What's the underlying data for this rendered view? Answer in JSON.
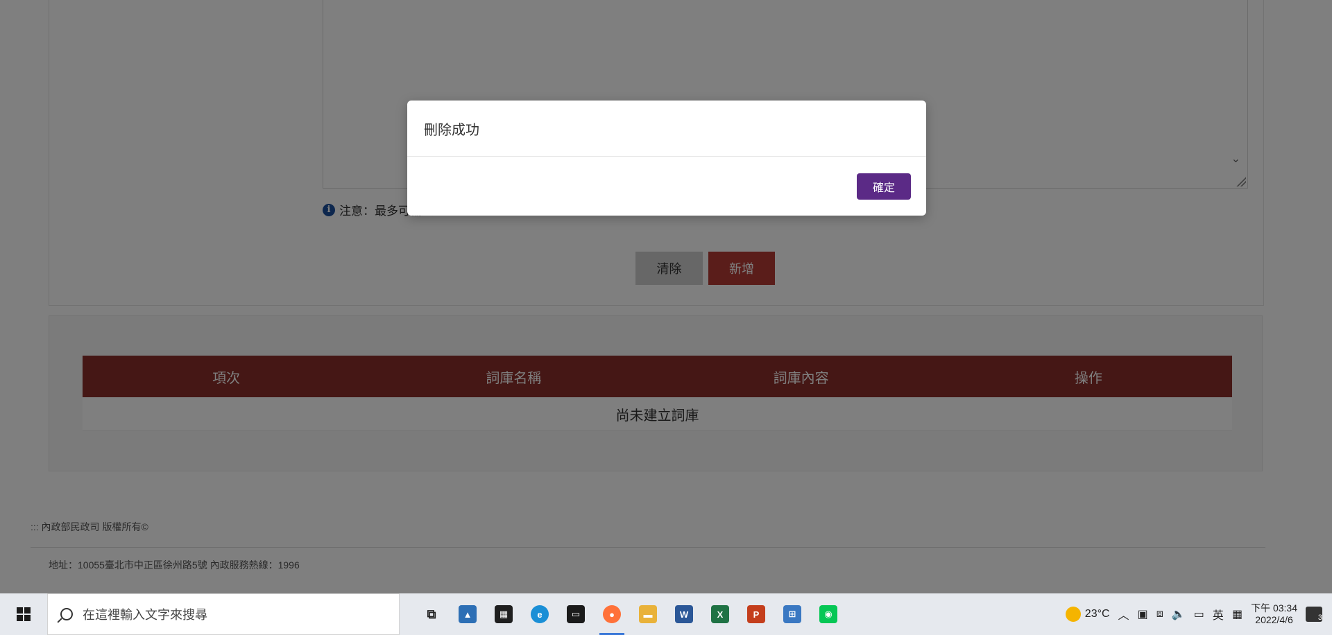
{
  "page": {
    "note_text": "注意：最多可輸入",
    "clear_label": "清除",
    "add_label": "新增",
    "table": {
      "headers": [
        "項次",
        "詞庫名稱",
        "詞庫內容",
        "操作"
      ],
      "empty_text": "尚未建立詞庫"
    },
    "footer": {
      "copyright": "::: 內政部民政司 版權所有©",
      "address": "地址：10055臺北市中正區徐州路5號 內政服務熱線：1996"
    }
  },
  "modal": {
    "message": "刪除成功",
    "ok_label": "確定"
  },
  "taskbar": {
    "search_placeholder": "在這裡輸入文字來搜尋",
    "weather_temp": "23°C",
    "ime_label": "英",
    "time": "下午 03:34",
    "date": "2022/4/6",
    "notification_count": "3"
  },
  "colors": {
    "table_header": "#8a2f2a",
    "add_button": "#b53a34",
    "ok_button": "#5b2a86"
  }
}
